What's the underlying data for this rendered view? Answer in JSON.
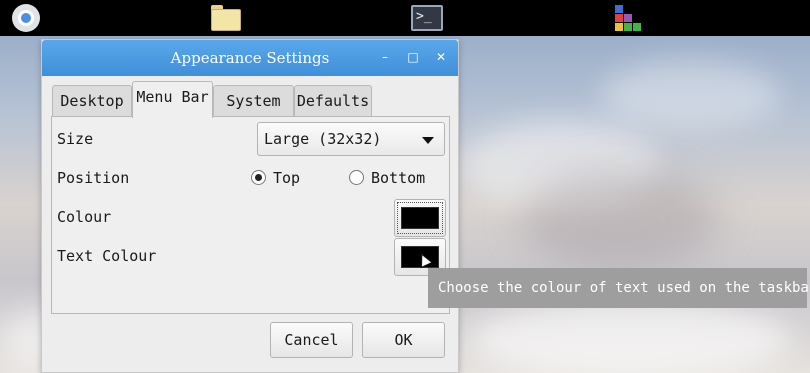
{
  "taskbar": {
    "items": [
      {
        "name": "chrome-icon"
      },
      {
        "name": "folder-icon"
      },
      {
        "name": "terminal-icon",
        "glyph": ">_"
      },
      {
        "name": "paint-palette-icon"
      }
    ]
  },
  "dialog": {
    "title": "Appearance Settings",
    "controls": {
      "minimize": "–",
      "maximize": "□",
      "close": "✕"
    },
    "tabs": [
      {
        "label": "Desktop",
        "active": false
      },
      {
        "label": "Menu Bar",
        "active": true
      },
      {
        "label": "System",
        "active": false
      },
      {
        "label": "Defaults",
        "active": false
      }
    ],
    "size": {
      "label": "Size",
      "value": "Large (32x32)"
    },
    "position": {
      "label": "Position",
      "options": [
        {
          "label": "Top",
          "selected": true
        },
        {
          "label": "Bottom",
          "selected": false
        }
      ]
    },
    "colour": {
      "label": "Colour",
      "value": "#000000"
    },
    "text_colour": {
      "label": "Text Colour",
      "value": "#000000"
    },
    "buttons": {
      "cancel": "Cancel",
      "ok": "OK"
    }
  },
  "tooltip": {
    "text": "Choose the colour of text used on the taskbar"
  }
}
